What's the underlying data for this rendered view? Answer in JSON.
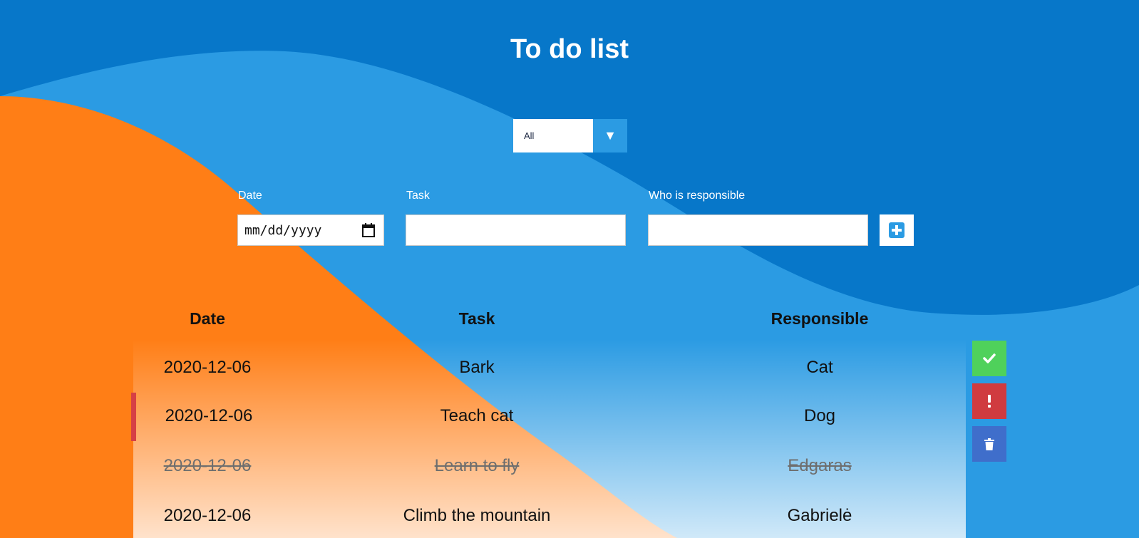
{
  "page": {
    "title": "To do list"
  },
  "filter": {
    "selected": "All",
    "arrow": "▼"
  },
  "form": {
    "date_label": "Date",
    "date_placeholder": "mm/dd/yyyy",
    "task_label": "Task",
    "task_value": "",
    "responsible_label": "Who is responsible",
    "responsible_value": "",
    "add_icon": "plus-square-icon"
  },
  "table": {
    "headers": [
      "Date",
      "Task",
      "Responsible"
    ],
    "rows": [
      {
        "date": "2020-12-06",
        "task": "Bark",
        "responsible": "Cat",
        "completed": false,
        "important": false
      },
      {
        "date": "2020-12-06",
        "task": "Teach cat",
        "responsible": "Dog",
        "completed": false,
        "important": true
      },
      {
        "date": "2020-12-06",
        "task": "Learn to fly",
        "responsible": "Edgaras",
        "completed": true,
        "important": false
      },
      {
        "date": "2020-12-06",
        "task": "Climb the mountain",
        "responsible": "Gabrielė",
        "completed": false,
        "important": false
      }
    ]
  },
  "actions": {
    "complete_icon": "check-icon",
    "important_icon": "exclamation-icon",
    "delete_icon": "trash-icon"
  },
  "colors": {
    "background_dark_blue": "#0777c9",
    "background_light_blue": "#2b9be3",
    "orange": "#ff7e16",
    "complete_green": "#4fd15b",
    "important_red": "#d03b3f",
    "delete_blue": "#3f6ecb"
  }
}
